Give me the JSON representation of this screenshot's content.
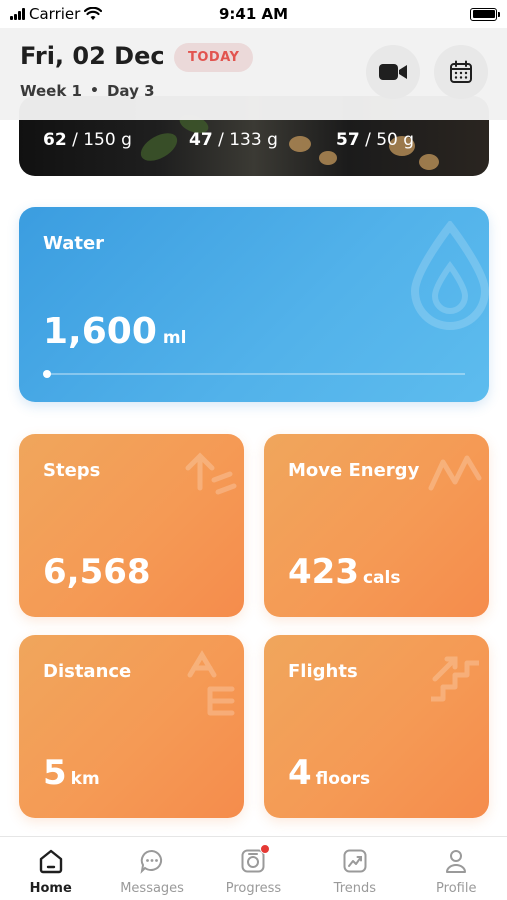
{
  "status_bar": {
    "carrier": "Carrier",
    "time": "9:41 AM"
  },
  "header": {
    "date": "Fri, 02 Dec",
    "badge": "TODAY",
    "week": "Week 1",
    "separator": "•",
    "day": "Day 3",
    "video_icon": "video-camera-icon",
    "calendar_icon": "calendar-icon"
  },
  "macros": [
    {
      "value": "62",
      "goal": "150 g"
    },
    {
      "value": "47",
      "goal": "133 g"
    },
    {
      "value": "57",
      "goal": "50 g"
    }
  ],
  "water": {
    "label": "Water",
    "value": "1,600",
    "unit": "ml",
    "progress": 0.0,
    "icon": "water-drop-icon"
  },
  "stats": {
    "steps": {
      "label": "Steps",
      "value": "6,568",
      "unit": ""
    },
    "move_energy": {
      "label": "Move Energy",
      "value": "423",
      "unit": "cals"
    },
    "distance": {
      "label": "Distance",
      "value": "5",
      "unit": "km"
    },
    "flights": {
      "label": "Flights",
      "value": "4",
      "unit": "floors"
    }
  },
  "tabs": [
    {
      "label": "Home",
      "icon": "home-icon",
      "active": true
    },
    {
      "label": "Messages",
      "icon": "chat-bubble-icon",
      "active": false
    },
    {
      "label": "Progress",
      "icon": "camera-icon",
      "active": false,
      "notification": true
    },
    {
      "label": "Trends",
      "icon": "trend-chart-icon",
      "active": false
    },
    {
      "label": "Profile",
      "icon": "person-icon",
      "active": false
    }
  ],
  "colors": {
    "water_card": "#52b2ea",
    "stat_card": "#f59a55",
    "badge_text": "#e2544f",
    "notification": "#e53935"
  }
}
